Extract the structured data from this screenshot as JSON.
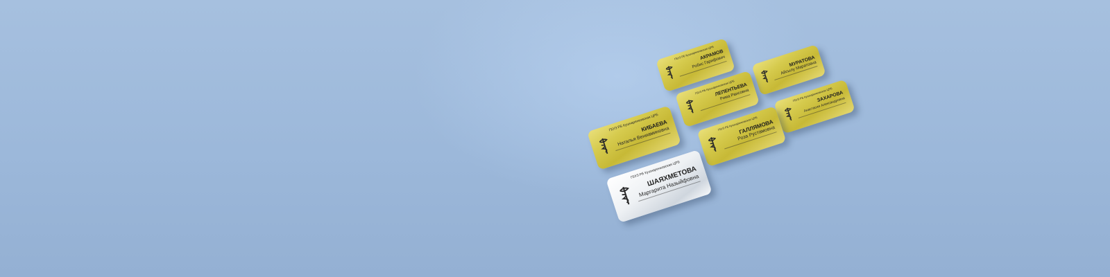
{
  "colors": {
    "background": "#9cb8da",
    "gold_plate": "#d6cb4e",
    "silver_plate": "#eef1f4",
    "text": "#1f1f1f"
  },
  "badges": [
    {
      "material": "gold",
      "icon": "medical-snake-icon",
      "org": "ГБУЗ РБ Кушнаренковская ЦРБ",
      "surname": "АКРАМОВ",
      "given": "Робис Гарифович",
      "role": ""
    },
    {
      "material": "gold",
      "icon": "medical-snake-icon",
      "org": "",
      "surname": "МУРАТОВА",
      "given": "Айсылу Маратовна",
      "role": ""
    },
    {
      "material": "gold",
      "icon": "medical-snake-icon",
      "org": "ГБУЗ РБ Кушнаренковская ЦРБ",
      "surname": "ЛЕПЕНТЬЕВА",
      "given": "Рима Раисовна",
      "role": ""
    },
    {
      "material": "gold",
      "icon": "medical-snake-icon",
      "org": "ГБУЗ РБ Кушнаренковская ЦРБ",
      "surname": "ЗАХАРОВА",
      "given": "Анастасия Александровна",
      "role": ""
    },
    {
      "material": "gold",
      "icon": "medical-snake-icon",
      "org": "ГБУЗ РБ Кушнаренковская ЦРБ",
      "surname": "КИБАЕВА",
      "given": "Наталья Вениаминовна",
      "role": ""
    },
    {
      "material": "gold",
      "icon": "medical-snake-icon",
      "org": "ГБУЗ РБ Кушнаренковская ЦРБ",
      "surname": "ГАЛЛЯМОВА",
      "given": "Роза Рустамовна",
      "role": ""
    },
    {
      "material": "silver",
      "icon": "medical-snake-icon",
      "org": "ГБУЗ РБ Кушнаренковская ЦРБ",
      "surname": "ШАЯХМЕТОВА",
      "given": "Маргарита Назыйфовна",
      "role": ""
    }
  ]
}
